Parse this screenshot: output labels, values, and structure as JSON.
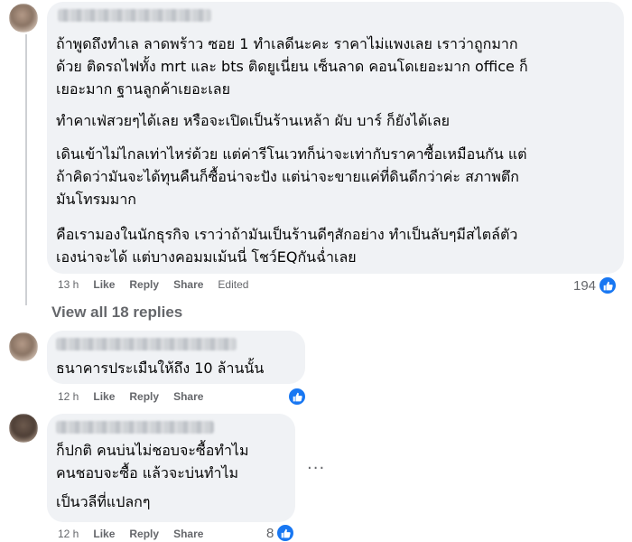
{
  "comment_main": {
    "paragraphs": [
      "ถ้าพูดถึงทำเล ลาดพร้าว ซอย 1 ทำเลดีนะคะ ราคาไม่แพงเลย เราว่าถูกมาก\nด้วย ติดรถไฟทั้ง mrt และ bts ติดยูเนี่ยน เซ็นลาด คอนโดเยอะมาก office ก็\nเยอะมาก ฐานลูกค้าเยอะเลย",
      "ทำคาเฟ่สวยๆได้เลย หรือจะเปิดเป็นร้านเหล้า ผับ บาร์ ก็ยังได้เลย",
      "เดินเข้าไม่ไกลเท่าไหร่ด้วย แต่ค่ารีโนเวทก็น่าจะเท่ากับราคาซื้อเหมือนกัน แต่\nถ้าคิดว่ามันจะได้ทุนคืนก็ซื้อน่าจะปัง แต่น่าจะขายแค่ที่ดินดีกว่าค่ะ สภาพตึก\nมันโทรมมาก",
      "คือเรามองในนักธุรกิจ เราว่าถ้ามันเป็นร้านดีๆสักอย่าง ทำเป็นลับๆมีสไตล์ตัว\nเองน่าจะได้ แต่บางคอมมเม้นนี่ โชว์EQกันฉ่ำเลย"
    ],
    "time": "13 h",
    "like": "Like",
    "reply": "Reply",
    "share": "Share",
    "edited": "Edited",
    "reactions": "194"
  },
  "view_all_replies": "View all 18 replies",
  "reply_1": {
    "text": "ธนาคารประเมืนให้ถึง 10 ล้านนั้น",
    "time": "12 h",
    "like": "Like",
    "reply": "Reply",
    "share": "Share"
  },
  "reply_2": {
    "paragraphs": [
      "ก็ปกติ คนบ่นไม่ชอบจะซื้อทำไม\nคนชอบจะซื้อ แล้วจะบ่นทำไม",
      "เป็นวลีที่แปลกๆ"
    ],
    "time": "12 h",
    "like": "Like",
    "reply": "Reply",
    "share": "Share",
    "reactions": "8"
  },
  "more_options": "···",
  "colors": {
    "bubble": "#f0f2f5",
    "meta_text": "#65676b",
    "like_blue": "#1877f2"
  },
  "icons": {
    "like": "thumbs-up-icon",
    "more": "more-options-icon"
  }
}
